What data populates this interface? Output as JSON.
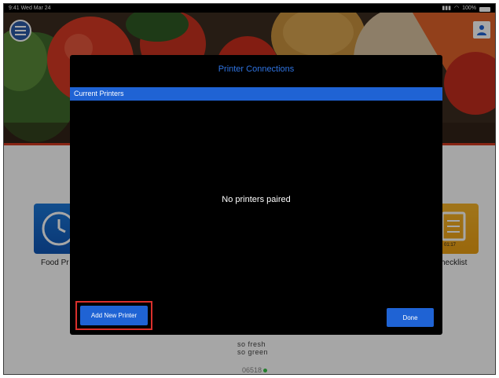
{
  "status_bar": {
    "time_date": "9:41  Wed Mar 24",
    "battery": "100%"
  },
  "dashboard": {
    "tiles": [
      {
        "label": "Food Pr"
      },
      {
        "label": "hecklist",
        "badge": "01:17"
      }
    ],
    "logo_line1": "so fresh",
    "logo_line2": "so green",
    "code": "06518"
  },
  "modal": {
    "title": "Printer Connections",
    "section_header": "Current Printers",
    "empty_message": "No printers paired",
    "add_button": "Add New Printer",
    "done_button": "Done"
  },
  "colors": {
    "accent": "#1f63d4",
    "title": "#2f73e0",
    "highlight": "#d9302c",
    "modal_bg": "#000000"
  }
}
